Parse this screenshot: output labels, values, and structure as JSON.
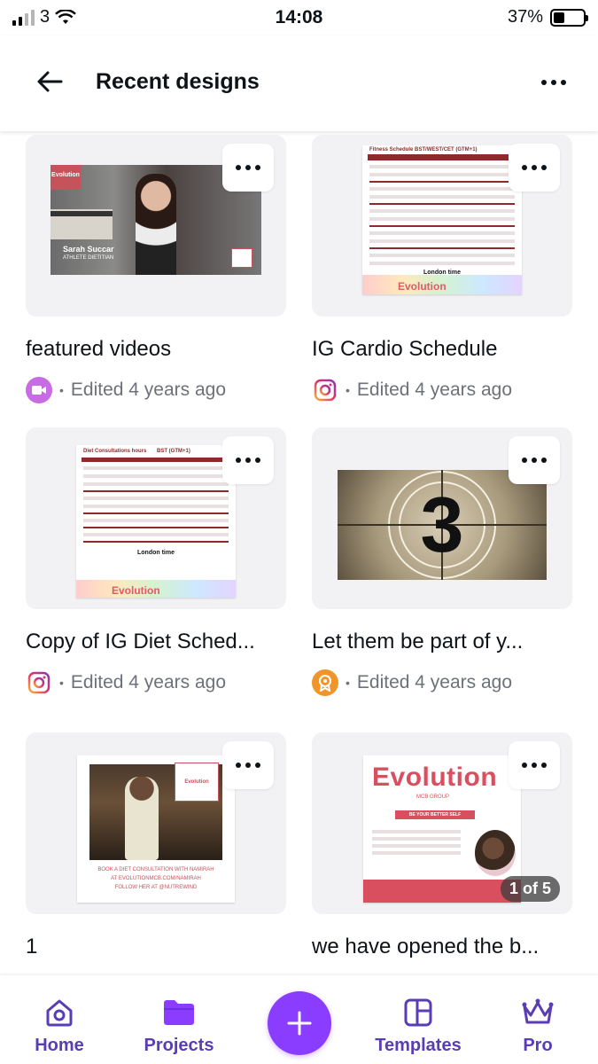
{
  "status_bar": {
    "carrier": "3",
    "time": "14:08",
    "battery_pct": "37%",
    "battery_level": 0.37
  },
  "header": {
    "title": "Recent designs",
    "back_icon": "arrow-left-icon",
    "more_icon": "more-horizontal-icon"
  },
  "designs": [
    {
      "title": "featured videos",
      "edited": "Edited 4 years ago",
      "app_icon": "video-icon",
      "app_color": "#c86ce6",
      "thumb": {
        "caption_name": "Sarah Succar",
        "caption_role": "ATHLETE DIETITIAN",
        "logo": "Evolution"
      }
    },
    {
      "title": "IG Cardio Schedule",
      "edited": "Edited 4 years ago",
      "app_icon": "instagram-icon",
      "app_color": "#e1306c",
      "thumb": {
        "heading": "Fitness Schedule",
        "zone": "BST/WEST/CET (GTM+1)",
        "footer": "London time",
        "brand": "Evolution"
      }
    },
    {
      "title": "Copy of IG Diet Sched...",
      "edited": "Edited 4 years ago",
      "app_icon": "instagram-icon",
      "app_color": "#e1306c",
      "thumb": {
        "heading": "Diet Consultations hours",
        "zone": "BST (GTM+1)",
        "footer": "London time",
        "brand": "Evolution"
      }
    },
    {
      "title": "Let them be part of y...",
      "edited": "Edited 4 years ago",
      "app_icon": "badge-icon",
      "app_color": "#f0952a",
      "thumb": {
        "countdown": "3"
      }
    },
    {
      "title": "1",
      "edited": "",
      "app_icon": "",
      "app_color": "",
      "thumb": {
        "caption_1": "BOOK A DIET CONSULTATION WITH NAMIRAH",
        "caption_2": "AT EVOLUTIONMCB.COM/NAMIRAH",
        "caption_3": "FOLLOW HER AT @NUTREWIND",
        "logo": "Evolution"
      }
    },
    {
      "title": "we have opened the b...",
      "edited": "",
      "app_icon": "",
      "app_color": "",
      "thumb": {
        "brand": "Evolution",
        "sub": "MCB GROUP",
        "tagline": "BE YOUR BETTER SELF",
        "page_badge": "1 of 5"
      }
    }
  ],
  "bottom_nav": {
    "home": "Home",
    "projects": "Projects",
    "templates": "Templates",
    "pro": "Pro",
    "accent_color": "#8b3dff",
    "label_color": "#5a3db5"
  }
}
